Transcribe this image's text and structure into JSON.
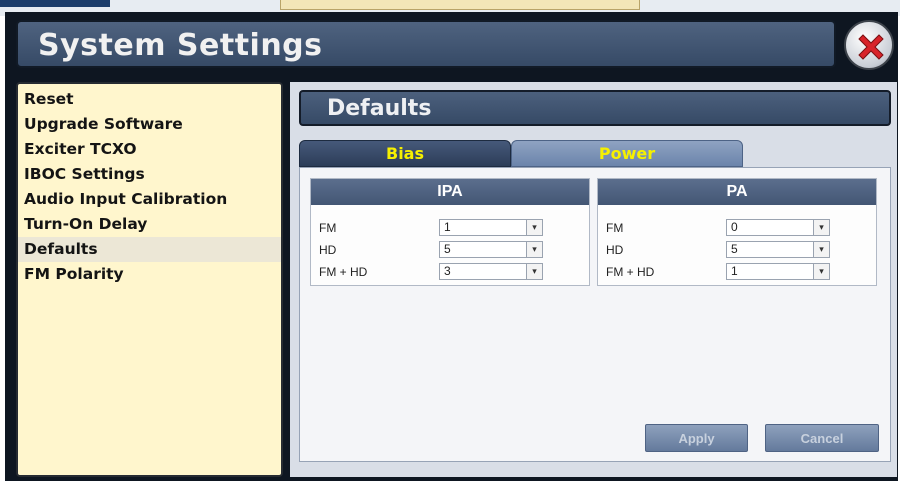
{
  "window": {
    "title": "System Settings"
  },
  "sidebar": {
    "items": [
      {
        "label": "Reset"
      },
      {
        "label": "Upgrade Software"
      },
      {
        "label": "Exciter TCXO"
      },
      {
        "label": "IBOC Settings"
      },
      {
        "label": "Audio Input Calibration"
      },
      {
        "label": "Turn-On Delay"
      },
      {
        "label": "Defaults",
        "selected": true
      },
      {
        "label": "FM Polarity"
      }
    ]
  },
  "main": {
    "section_title": "Defaults",
    "tabs": [
      {
        "label": "Bias",
        "active": true
      },
      {
        "label": "Power",
        "active": false
      }
    ],
    "ipa": {
      "title": "IPA",
      "rows": [
        {
          "label": "FM",
          "value": "1"
        },
        {
          "label": "HD",
          "value": "5"
        },
        {
          "label": "FM + HD",
          "value": "3"
        }
      ]
    },
    "pa": {
      "title": "PA",
      "rows": [
        {
          "label": "FM",
          "value": "0"
        },
        {
          "label": "HD",
          "value": "5"
        },
        {
          "label": "FM + HD",
          "value": "1"
        }
      ]
    },
    "buttons": {
      "apply": "Apply",
      "cancel": "Cancel"
    }
  },
  "icons": {
    "close": "close-x-icon",
    "dropdown": "chevron-down-icon"
  },
  "colors": {
    "accent": "#364a66",
    "tab_text": "#f6f000",
    "sidebar_bg": "#fff6cd",
    "close_red": "#d8232a"
  }
}
